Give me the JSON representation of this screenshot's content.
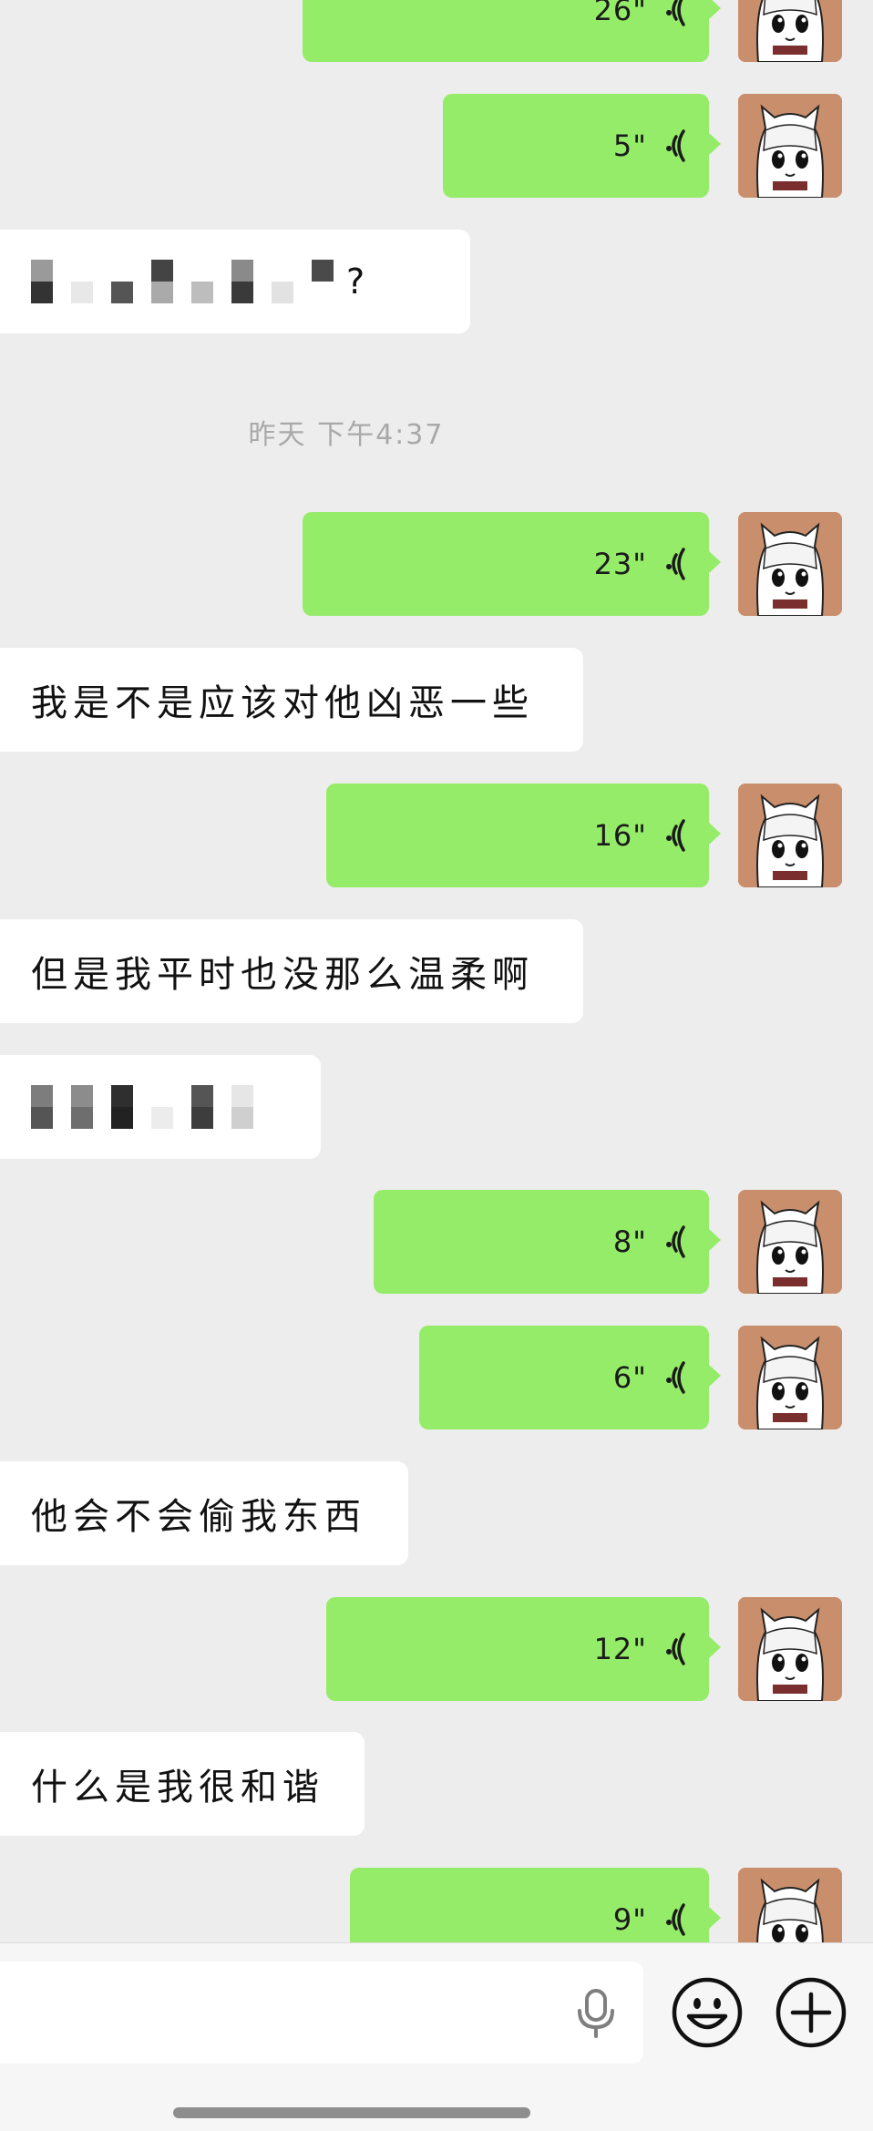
{
  "theme": {
    "background": "#ededed",
    "outgoing_bubble": "#95ec69",
    "incoming_bubble": "#ffffff",
    "timestamp_color": "#a9a9a9",
    "avatar_bg": "#c98f6c"
  },
  "timestamp": "昨天 下午4:37",
  "messages": {
    "m1": {
      "direction": "outgoing",
      "type": "voice",
      "duration": "26\""
    },
    "m2": {
      "direction": "outgoing",
      "type": "voice",
      "duration": "5\""
    },
    "m3": {
      "direction": "incoming",
      "type": "text",
      "suffix": "?"
    },
    "m4": {
      "direction": "outgoing",
      "type": "voice",
      "duration": "23\""
    },
    "m5": {
      "direction": "incoming",
      "type": "text",
      "text": "我是不是应该对他凶恶一些"
    },
    "m6": {
      "direction": "outgoing",
      "type": "voice",
      "duration": "16\""
    },
    "m7": {
      "direction": "incoming",
      "type": "text",
      "text": "但是我平时也没那么温柔啊"
    },
    "m8": {
      "direction": "incoming",
      "type": "text"
    },
    "m9": {
      "direction": "outgoing",
      "type": "voice",
      "duration": "8\""
    },
    "m10": {
      "direction": "outgoing",
      "type": "voice",
      "duration": "6\""
    },
    "m11": {
      "direction": "incoming",
      "type": "text",
      "text": "他会不会偷我东西"
    },
    "m12": {
      "direction": "outgoing",
      "type": "voice",
      "duration": "12\""
    },
    "m13": {
      "direction": "incoming",
      "type": "text",
      "text": "什么是我很和谐"
    },
    "m14": {
      "direction": "outgoing",
      "type": "voice",
      "duration": "9\""
    }
  },
  "input_bar": {
    "text_value": "",
    "icons": [
      "microphone-icon",
      "emoji-icon",
      "plus-icon"
    ]
  }
}
